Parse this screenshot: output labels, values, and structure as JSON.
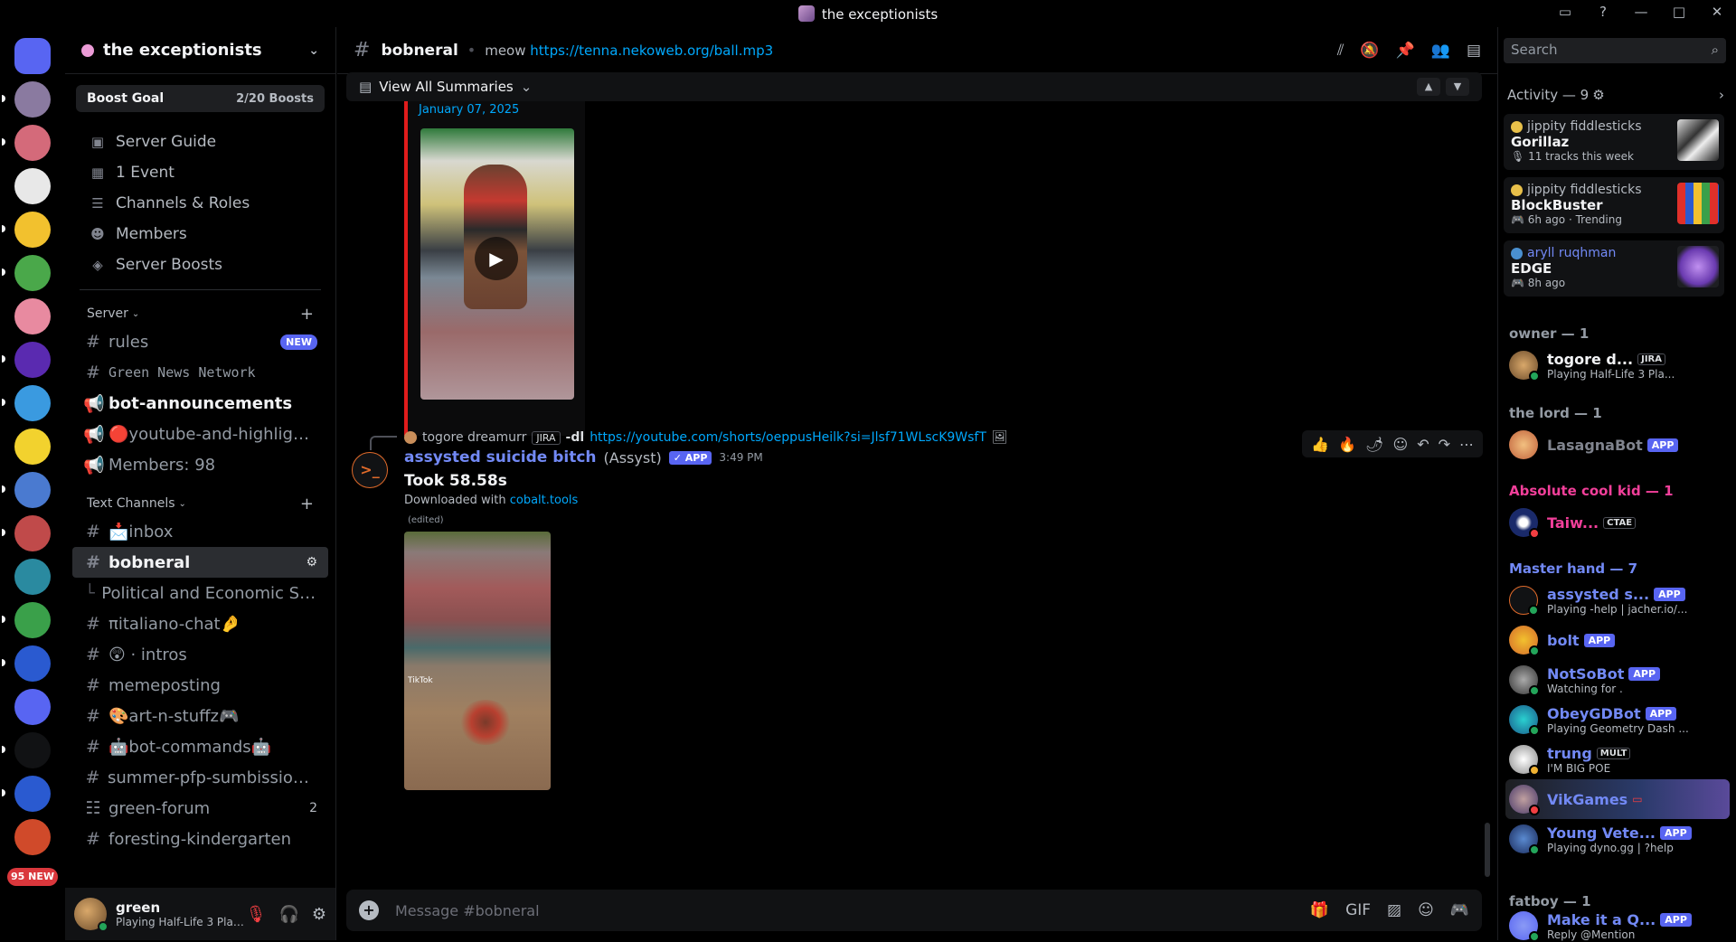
{
  "window": {
    "title": "the exceptionists",
    "controls": [
      "inbox-icon",
      "help-icon",
      "minimize-icon",
      "maximize-icon",
      "close-icon"
    ]
  },
  "guild_rail": {
    "new_badge": "95 NEW",
    "guilds": [
      {
        "name": "discord-home",
        "color": "#5865f2"
      },
      {
        "name": "guild-1",
        "color": "#8a7aa0"
      },
      {
        "name": "guild-2",
        "color": "#d46a7a"
      },
      {
        "name": "guild-3",
        "color": "#e8e8e8"
      },
      {
        "name": "guild-4",
        "color": "#f2c12e"
      },
      {
        "name": "guild-5",
        "color": "#4aa84a"
      },
      {
        "name": "guild-6",
        "color": "#e88aa0"
      },
      {
        "name": "guild-7",
        "color": "#5a2ab0"
      },
      {
        "name": "guild-8",
        "color": "#3a9ae0"
      },
      {
        "name": "guild-9",
        "color": "#f2d22e"
      },
      {
        "name": "guild-10",
        "color": "#4a7ad0"
      },
      {
        "name": "guild-11",
        "color": "#c04a4a"
      },
      {
        "name": "guild-12",
        "color": "#2a8aa0"
      },
      {
        "name": "guild-13",
        "color": "#3aa04a"
      },
      {
        "name": "guild-14",
        "color": "#2a5ad0"
      },
      {
        "name": "guild-15",
        "color": "#5865f2"
      },
      {
        "name": "guild-16",
        "color": "#111214"
      },
      {
        "name": "guild-17",
        "color": "#2a5ad0"
      },
      {
        "name": "guild-18",
        "color": "#d04a2a"
      }
    ]
  },
  "server": {
    "name": "the exceptionists",
    "boost_label": "Boost Goal",
    "boost_count": "2/20 Boosts",
    "nav": [
      {
        "label": "Server Guide",
        "icon": "guide-icon"
      },
      {
        "label": "1 Event",
        "icon": "calendar-icon"
      },
      {
        "label": "Channels & Roles",
        "icon": "channels-icon"
      },
      {
        "label": "Members",
        "icon": "members-icon"
      },
      {
        "label": "Server Boosts",
        "icon": "boost-icon"
      }
    ],
    "category_server": "Server",
    "category_text": "Text Channels",
    "channels_server": [
      {
        "label": "rules",
        "badge": "NEW"
      },
      {
        "label": "Green News Network"
      },
      {
        "label": "bot-announcements"
      },
      {
        "label": "🔴youtube-and-highlights..."
      },
      {
        "label": "Members: 98"
      }
    ],
    "channels_text": [
      {
        "label": "📩inbox"
      },
      {
        "label": "bobneral"
      },
      {
        "label": "Political and Economic Stat..."
      },
      {
        "label": "πitaliano-chat🤌"
      },
      {
        "label": "😲 · intros"
      },
      {
        "label": "memeposting"
      },
      {
        "label": "🎨art-n-stuffz🎮"
      },
      {
        "label": "🤖bot-commands🤖"
      },
      {
        "label": "summer-pfp-sumbissions..."
      },
      {
        "label": "green-forum",
        "count": "2"
      },
      {
        "label": "foresting-kindergarten"
      }
    ]
  },
  "user": {
    "name": "green",
    "status": "Playing Half-Life 3 Playt..."
  },
  "channel": {
    "name": "bobneral",
    "topic_prefix": "meow",
    "topic_link": "https://tenna.nekoweb.org/ball.mp3"
  },
  "summaries": {
    "label": "View All Summaries"
  },
  "prev_embed": {
    "date": "January 07, 2025"
  },
  "message": {
    "reply_author": "togore dreamurr",
    "reply_tag": "JIRA",
    "reply_cmd": "-dl",
    "reply_link": "https://youtube.com/shorts/oeppusHeilk?si=Jlsf71WLscK9WsfT",
    "author": "assysted suicide bitch",
    "nick": "(Assyst)",
    "app_tag": "APP",
    "time": "3:49 PM",
    "line1": "Took 58.58s",
    "line2_prefix": "Downloaded with",
    "line2_link": "cobalt.tools",
    "edited": "(edited)",
    "video_watermark": "TikTok"
  },
  "composer": {
    "placeholder": "Message #bobneral"
  },
  "search": {
    "placeholder": "Search"
  },
  "activity": {
    "header": "Activity — 9",
    "cards": [
      {
        "who": "jippity fiddlesticks",
        "what": "Gorillaz",
        "meta": "11 tracks this week"
      },
      {
        "who": "jippity fiddlesticks",
        "what": "BlockBuster",
        "meta": "6h ago · Trending"
      },
      {
        "who": "aryll ruqhman",
        "what": "EDGE",
        "meta": "8h ago"
      }
    ]
  },
  "member_groups": {
    "owner": "owner — 1",
    "lord": "the lord — 1",
    "kid": "Absolute cool kid — 1",
    "master": "Master hand — 7",
    "fatboy": "fatboy — 1"
  },
  "members": [
    {
      "name": "togore d...",
      "tag": "JIRA",
      "status": "Playing Half-Life 3 Pla...",
      "color": "#f2f3f5"
    },
    {
      "name": "LasagnaBot",
      "tag": "APP",
      "status": "",
      "color": "#80848e"
    },
    {
      "name": "Taiw...",
      "tag": "CTAE",
      "status": "",
      "color": "#f23f9a"
    },
    {
      "name": "assysted s...",
      "tag": "APP",
      "status": "Playing -help | jacher.io/...",
      "color": "#7289f5"
    },
    {
      "name": "bolt",
      "tag": "APP",
      "status": "",
      "color": "#7289f5"
    },
    {
      "name": "NotSoBot",
      "tag": "APP",
      "status": "Watching for .",
      "color": "#7289f5"
    },
    {
      "name": "ObeyGDBot",
      "tag": "APP",
      "status": "Playing Geometry Dash ...",
      "color": "#7289f5"
    },
    {
      "name": "trung",
      "tag": "MULT",
      "status": "I'M BIG POE",
      "color": "#7289f5"
    },
    {
      "name": "VikGames",
      "tag": "",
      "status": "",
      "color": "#7289f5"
    },
    {
      "name": "Young Vete...",
      "tag": "APP",
      "status": "Playing dyno.gg | ?help",
      "color": "#7289f5"
    },
    {
      "name": "Make it a Q...",
      "tag": "APP",
      "status": "Reply @Mention",
      "color": "#7289f5"
    }
  ]
}
